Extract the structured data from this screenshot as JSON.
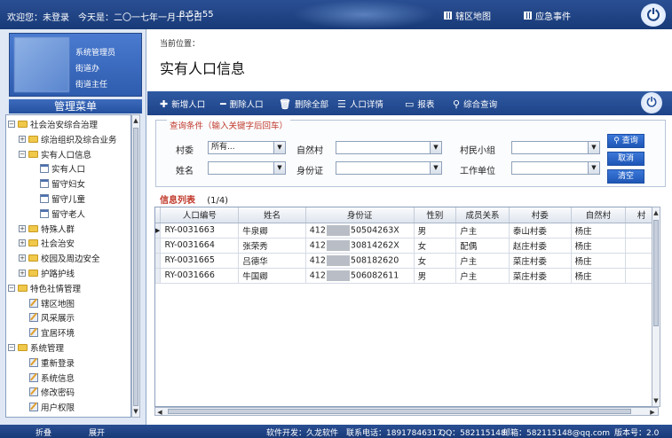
{
  "topbar": {
    "welcome": "欢迎您：未登录",
    "date": "今天是：二〇一七年一月十七日",
    "time": "8:53:55",
    "nav_map": "辖区地图",
    "nav_emergency": "应急事件",
    "power_icon": "power-icon"
  },
  "user": {
    "role1": "系统管理员",
    "role2": "街道办",
    "role3": "街道主任"
  },
  "menu": {
    "title": "管理菜单",
    "items": [
      {
        "label": "社会治安综合治理",
        "expander": "−",
        "icon": "folder-icon"
      },
      {
        "label": "综治组织及综合业务",
        "expander": "+",
        "icon": "folder-icon"
      },
      {
        "label": "实有人口信息",
        "expander": "−",
        "icon": "folder-icon"
      },
      {
        "label": "实有人口",
        "icon": "page-icon"
      },
      {
        "label": "留守妇女",
        "icon": "page-icon"
      },
      {
        "label": "留守儿童",
        "icon": "page-icon"
      },
      {
        "label": "留守老人",
        "icon": "page-icon"
      },
      {
        "label": "特殊人群",
        "expander": "+",
        "icon": "folder-icon"
      },
      {
        "label": "社会治安",
        "expander": "+",
        "icon": "folder-icon"
      },
      {
        "label": "校园及周边安全",
        "expander": "+",
        "icon": "folder-icon"
      },
      {
        "label": "护路护线",
        "expander": "+",
        "icon": "folder-icon"
      },
      {
        "label": "特色社情管理",
        "expander": "−",
        "icon": "folder-icon"
      },
      {
        "label": "辖区地图",
        "icon": "edit-icon"
      },
      {
        "label": "风采展示",
        "icon": "edit-icon"
      },
      {
        "label": "宜居环境",
        "icon": "edit-icon"
      },
      {
        "label": "系统管理",
        "expander": "−",
        "icon": "folder-icon"
      },
      {
        "label": "重新登录",
        "icon": "edit-icon"
      },
      {
        "label": "系统信息",
        "icon": "edit-icon"
      },
      {
        "label": "修改密码",
        "icon": "edit-icon"
      },
      {
        "label": "用户权限",
        "icon": "edit-icon"
      }
    ]
  },
  "bottombar": {
    "collapse": "折叠",
    "expand": "展开",
    "dev": "软件开发：久龙软件",
    "phone": "联系电话：18917846317",
    "qq": "QQ：582115148",
    "email": "邮箱：582115148@qq.com",
    "version": "版本号：2.0"
  },
  "main": {
    "crumb": "当前位置：",
    "title": "实有人口信息",
    "toolbar": {
      "add": "新增人口",
      "delete": "删除人口",
      "delete_all": "删除全部",
      "detail": "人口详情",
      "report": "报表",
      "combined_query": "综合查询"
    },
    "query": {
      "legend": "查询条件（输入关键字后回车）",
      "village_committee_label": "村委",
      "village_committee_value": "所有...",
      "natural_village_label": "自然村",
      "villager_group_label": "村民小组",
      "name_label": "姓名",
      "id_card_label": "身份证",
      "work_unit_label": "工作单位",
      "search_btn": "查询",
      "cancel_btn": "取消",
      "clear_btn": "清空"
    },
    "list": {
      "title": "信息列表",
      "page": "(1/4)",
      "columns": [
        "人口编号",
        "姓名",
        "身份证",
        "性别",
        "成员关系",
        "村委",
        "自然村",
        "村"
      ],
      "rows": [
        {
          "id": "RY-0031663",
          "name": "牛泉卿",
          "idcard_prefix": "412",
          "idcard_suffix": "50504263X",
          "gender": "男",
          "relation": "户主",
          "committee": "泰山村委",
          "village": "杨庄"
        },
        {
          "id": "RY-0031664",
          "name": "张荣秀",
          "idcard_prefix": "412",
          "idcard_suffix": "30814262X",
          "gender": "女",
          "relation": "配偶",
          "committee": "赵庄村委",
          "village": "杨庄"
        },
        {
          "id": "RY-0031665",
          "name": "吕德华",
          "idcard_prefix": "412",
          "idcard_suffix": "508182620",
          "gender": "女",
          "relation": "户主",
          "committee": "菜庄村委",
          "village": "杨庄"
        },
        {
          "id": "RY-0031666",
          "name": "牛国卿",
          "idcard_prefix": "412",
          "idcard_suffix": "506082611",
          "gender": "男",
          "relation": "户主",
          "committee": "菜庄村委",
          "village": "杨庄"
        }
      ]
    }
  }
}
